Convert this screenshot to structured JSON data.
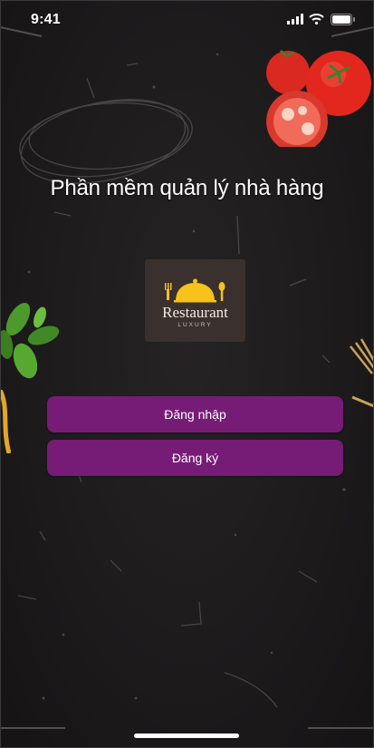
{
  "status_bar": {
    "time": "9:41",
    "icons": [
      "cellular-signal-icon",
      "wifi-icon",
      "battery-icon"
    ]
  },
  "main": {
    "title": "Phần mềm quản lý nhà hàng",
    "logo": {
      "name": "Restaurant",
      "subtitle": "LUXURY",
      "icon": "cloche-icon",
      "accent_color": "#f6c21b"
    },
    "buttons": {
      "login_label": "Đăng nhập",
      "register_label": "Đăng ký"
    }
  },
  "colors": {
    "background": "#1d1b1c",
    "button": "#761c76",
    "text": "#ffffff"
  }
}
